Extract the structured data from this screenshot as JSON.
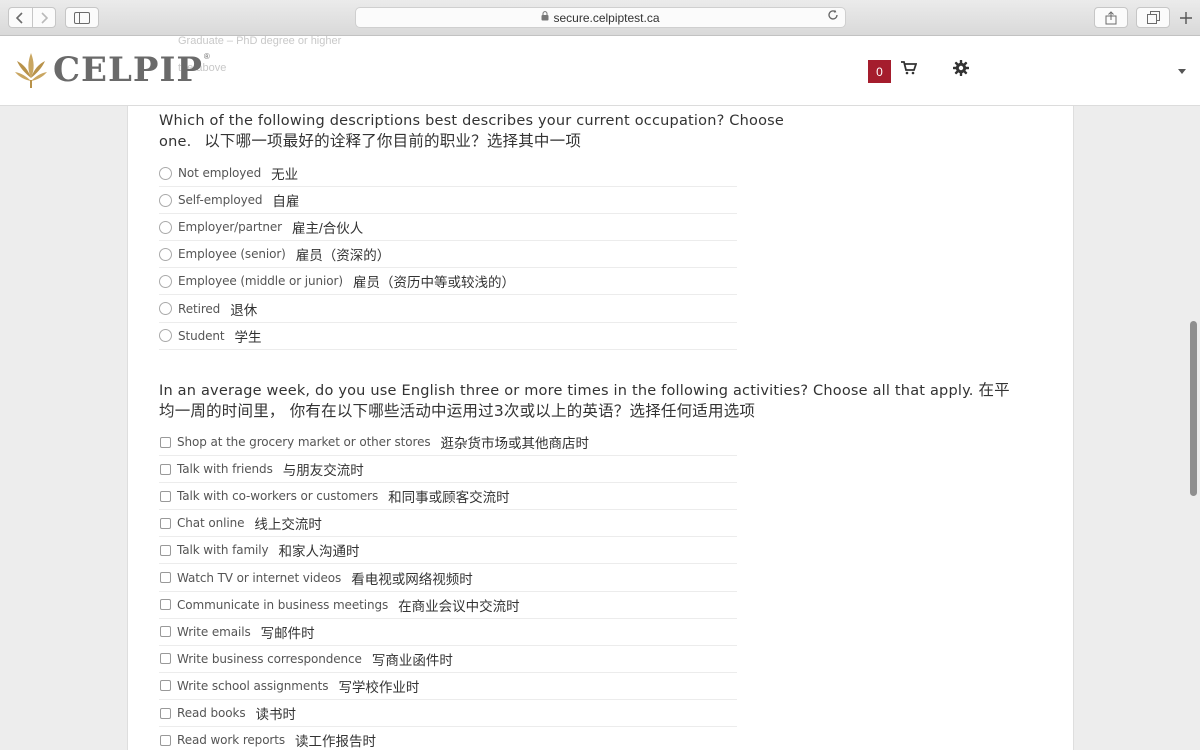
{
  "browser": {
    "url": "secure.celpiptest.ca",
    "icons": [
      "chevron-left-icon",
      "chevron-right-icon",
      "sidebar-icon",
      "lock-icon",
      "reload-icon",
      "share-icon",
      "tabs-icon",
      "plus-icon"
    ]
  },
  "header": {
    "logo_text": "CELPIP",
    "logo_reg": "®",
    "cart_count": "0",
    "ghost_lines": [
      "Graduate – PhD degree or higher",
      "the above"
    ],
    "brand_color": "#a51d2d"
  },
  "q_occupation": {
    "en": "Which of the following descriptions best describes your current occupation? Choose one.",
    "zh": "以下哪一项最好的诠释了你目前的职业？选择其中一项",
    "options": [
      {
        "en": "Not employed",
        "zh": "无业"
      },
      {
        "en": "Self-employed",
        "zh": "自雇"
      },
      {
        "en": "Employer/partner",
        "zh": "雇主/合伙人"
      },
      {
        "en": "Employee (senior)",
        "zh": "雇员（资深的）"
      },
      {
        "en": "Employee (middle or junior)",
        "zh": "雇员（资历中等或较浅的）"
      },
      {
        "en": "Retired",
        "zh": "退休"
      },
      {
        "en": "Student",
        "zh": "学生"
      }
    ]
  },
  "q_english": {
    "en": "In an average week, do you use English three or more times in the following activities? Choose all that apply.",
    "zh": "在平均一周的时间里， 你有在以下哪些活动中运用过3次或以上的英语？选择任何适用选项",
    "options": [
      {
        "en": "Shop at the grocery market or other stores",
        "zh": "逛杂货市场或其他商店时"
      },
      {
        "en": "Talk with friends",
        "zh": "与朋友交流时"
      },
      {
        "en": "Talk with co-workers or customers",
        "zh": "和同事或顾客交流时"
      },
      {
        "en": "Chat online",
        "zh": "线上交流时"
      },
      {
        "en": "Talk with family",
        "zh": "和家人沟通时"
      },
      {
        "en": "Watch TV or internet videos",
        "zh": "看电视或网络视频时"
      },
      {
        "en": "Communicate in business meetings",
        "zh": "在商业会议中交流时"
      },
      {
        "en": "Write emails",
        "zh": "写邮件时"
      },
      {
        "en": "Write business correspondence",
        "zh": "写商业函件时"
      },
      {
        "en": "Write school assignments",
        "zh": "写学校作业时"
      },
      {
        "en": "Read books",
        "zh": "读书时"
      },
      {
        "en": "Read work reports",
        "zh": "读工作报告时"
      }
    ]
  }
}
